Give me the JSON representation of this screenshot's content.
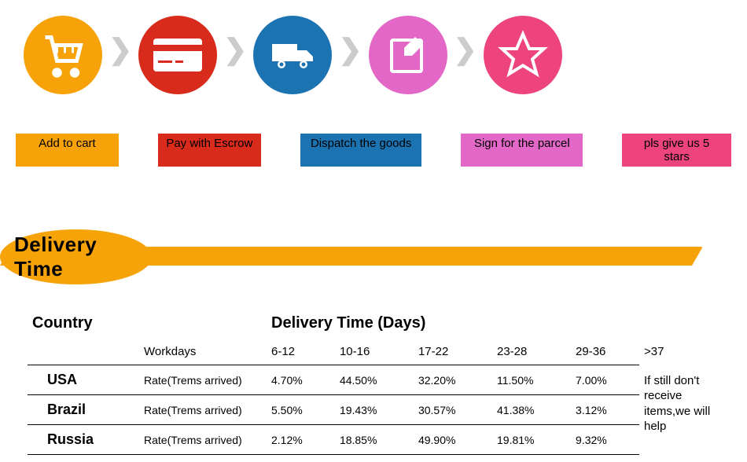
{
  "steps": [
    {
      "label": "Add to cart"
    },
    {
      "label": "Pay with Escrow"
    },
    {
      "label": "Dispatch the goods"
    },
    {
      "label": "Sign for the parcel"
    },
    {
      "label": "pls give us 5 stars"
    }
  ],
  "delivery_title": "Delivery Time",
  "table": {
    "country_header": "Country",
    "time_header": "Delivery Time (Days)",
    "workdays_label": "Workdays",
    "rate_label": "Rate(Trems arrived)",
    "ranges": [
      "6-12",
      "10-16",
      "17-22",
      "23-28",
      "29-36",
      ">37"
    ],
    "rows": [
      {
        "country": "USA",
        "values": [
          "4.70%",
          "44.50%",
          "32.20%",
          "11.50%",
          "7.00%"
        ]
      },
      {
        "country": "Brazil",
        "values": [
          "5.50%",
          "19.43%",
          "30.57%",
          "41.38%",
          "3.12%"
        ]
      },
      {
        "country": "Russia",
        "values": [
          "2.12%",
          "18.85%",
          "49.90%",
          "19.81%",
          "9.32%"
        ]
      }
    ],
    "note": "If still don't receive items,we will help"
  }
}
